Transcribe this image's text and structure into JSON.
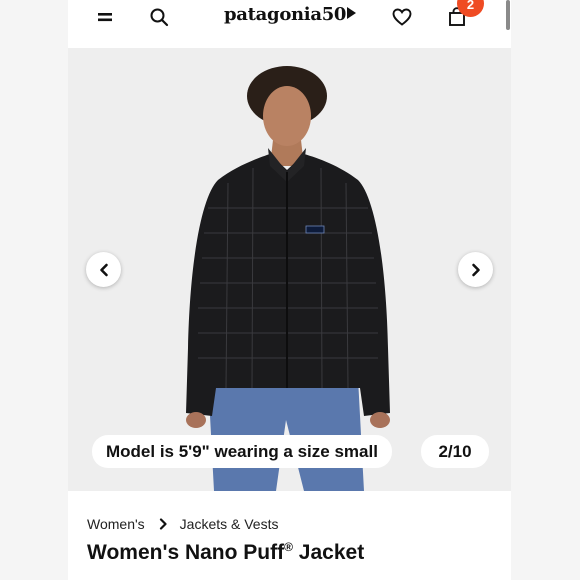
{
  "header": {
    "logo": "patagonia50",
    "cart_count": "2",
    "icons": [
      "menu-icon",
      "search-icon",
      "heart-icon",
      "bag-icon"
    ]
  },
  "gallery": {
    "caption": "Model is 5'9\" wearing a size small",
    "counter": "2/10",
    "icons": [
      "chevron-left-icon",
      "chevron-right-icon"
    ]
  },
  "breadcrumb": {
    "level1": "Women's",
    "level2": "Jackets & Vests"
  },
  "product": {
    "title": "Women's Nano Puff",
    "trademark": "®",
    "title_suffix": " Jacket"
  },
  "colors": {
    "accent": "#ef4b23",
    "jacket": "#1b1b1d",
    "pants": "#5a78ad"
  }
}
